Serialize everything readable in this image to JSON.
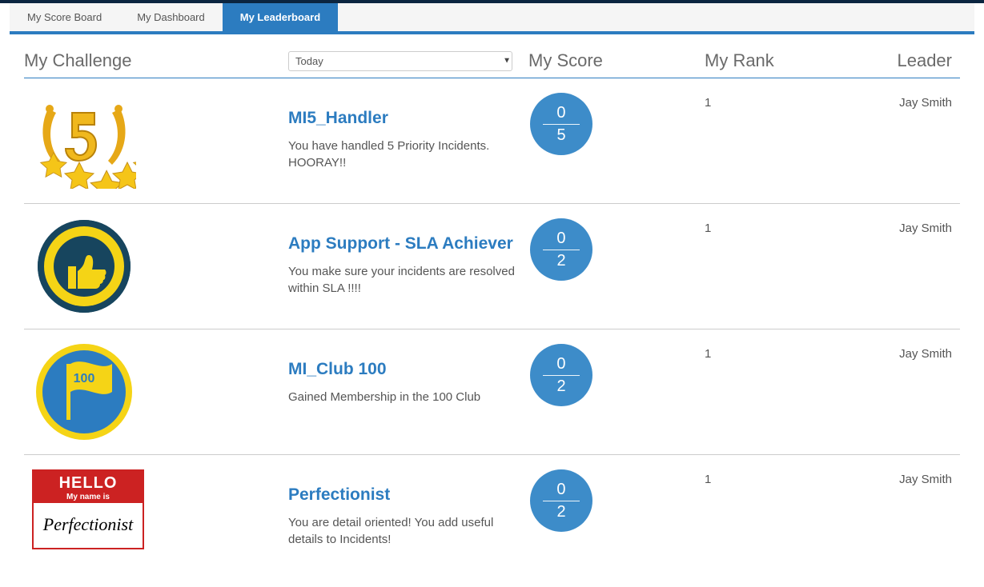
{
  "tabs": {
    "score_board": "My Score Board",
    "dashboard": "My Dashboard",
    "leaderboard": "My Leaderboard"
  },
  "headers": {
    "challenge": "My Challenge",
    "score": "My Score",
    "rank": "My Rank",
    "leader": "Leader"
  },
  "filter": {
    "selected": "Today"
  },
  "rows": [
    {
      "title": "MI5_Handler",
      "desc": "You have handled 5 Priority Incidents. HOORAY!!",
      "score_top": "0",
      "score_bottom": "5",
      "rank": "1",
      "leader": "Jay Smith"
    },
    {
      "title": "App Support - SLA Achiever",
      "desc": "You make sure your incidents are resolved within SLA !!!!",
      "score_top": "0",
      "score_bottom": "2",
      "rank": "1",
      "leader": "Jay Smith"
    },
    {
      "title": "MI_Club 100",
      "desc": "Gained Membership in the 100 Club",
      "score_top": "0",
      "score_bottom": "2",
      "rank": "1",
      "leader": "Jay Smith"
    },
    {
      "title": "Perfectionist",
      "desc": "You are detail oriented! You add useful details to Incidents!",
      "score_top": "0",
      "score_bottom": "2",
      "rank": "1",
      "leader": "Jay Smith"
    }
  ],
  "badge4": {
    "hello": "HELLO",
    "sub": "My name is",
    "name": "Perfectionist"
  }
}
